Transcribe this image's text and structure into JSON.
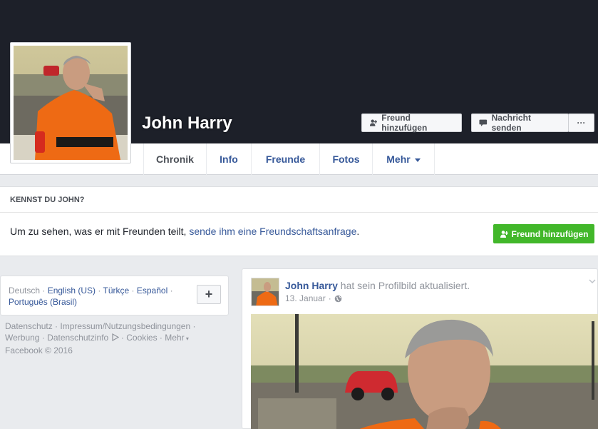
{
  "profile": {
    "name": "John Harry"
  },
  "actions": {
    "add_friend": "Freund hinzufügen",
    "send_message": "Nachricht senden",
    "more": "···"
  },
  "tabs": [
    {
      "label": "Chronik"
    },
    {
      "label": "Info"
    },
    {
      "label": "Freunde"
    },
    {
      "label": "Fotos"
    },
    {
      "label": "Mehr"
    }
  ],
  "know_panel": {
    "heading": "KENNST DU JOHN?",
    "text": "Um zu sehen, was er mit Freunden teilt, ",
    "link": "sende ihm eine Freundschaftsanfrage",
    "suffix": ".",
    "button": "Freund hinzufügen"
  },
  "languages": {
    "current": "Deutsch",
    "sep": " · ",
    "items": [
      "English (US)",
      "Türkçe",
      "Español",
      "Português (Brasil)"
    ],
    "add": "+"
  },
  "footer": {
    "links": [
      "Datenschutz",
      "Impressum/Nutzungsbedingungen",
      "Werbung",
      "Datenschutzinfo",
      "Cookies",
      "Mehr"
    ],
    "copyright": "Facebook © 2016"
  },
  "post": {
    "author": "John Harry",
    "action": " hat sein Profilbild aktualisiert.",
    "date": "13. Januar"
  },
  "colors": {
    "cover": "#1d2029",
    "link": "#365899",
    "green": "#42b72a",
    "background": "#e9ebee"
  }
}
